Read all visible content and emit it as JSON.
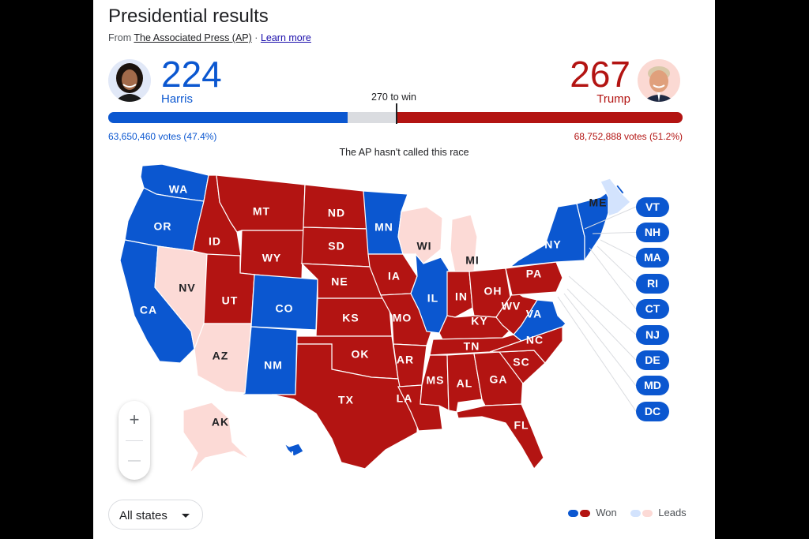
{
  "header": {
    "title": "Presidential results",
    "source_prefix": "From",
    "source_name": "The Associated Press (AP)",
    "separator": "·",
    "learn_more": "Learn more"
  },
  "candidates": {
    "harris": {
      "name": "Harris",
      "electoral_votes": "224",
      "votes_text": "63,650,460 votes (47.4%)",
      "electoral_fraction": 0.4164,
      "color": "#0b57d0"
    },
    "trump": {
      "name": "Trump",
      "electoral_votes": "267",
      "votes_text": "68,752,888 votes (51.2%)",
      "electoral_fraction": 0.4963,
      "color": "#b31412"
    }
  },
  "threshold": {
    "label": "270 to win",
    "fraction": 0.5019
  },
  "status": "The AP hasn't called this race",
  "colors": {
    "dem_won": "#0b57d0",
    "rep_won": "#b31412",
    "dem_leads": "#d3e3fd",
    "rep_leads": "#fcdad6"
  },
  "states": {
    "WA": "dem_won",
    "OR": "dem_won",
    "CA": "dem_won",
    "NV": "rep_leads",
    "ID": "rep_won",
    "MT": "rep_won",
    "WY": "rep_won",
    "UT": "rep_won",
    "AZ": "rep_leads",
    "CO": "dem_won",
    "NM": "dem_won",
    "ND": "rep_won",
    "SD": "rep_won",
    "NE": "rep_won",
    "KS": "rep_won",
    "OK": "rep_won",
    "TX": "rep_won",
    "MN": "dem_won",
    "IA": "rep_won",
    "MO": "rep_won",
    "AR": "rep_won",
    "LA": "rep_won",
    "WI": "rep_leads",
    "IL": "dem_won",
    "MI": "rep_leads",
    "IN": "rep_won",
    "OH": "rep_won",
    "KY": "rep_won",
    "TN": "rep_won",
    "MS": "rep_won",
    "AL": "rep_won",
    "GA": "rep_won",
    "FL": "rep_won",
    "SC": "rep_won",
    "NC": "rep_won",
    "VA": "dem_won",
    "WV": "rep_won",
    "PA": "rep_won",
    "NY": "dem_won",
    "ME": "dem_leads",
    "AK": "rep_leads",
    "HI": "dem_won",
    "NE_EAST": "dem_won"
  },
  "small_states": [
    "VT",
    "NH",
    "MA",
    "RI",
    "CT",
    "NJ",
    "DE",
    "MD",
    "DC"
  ],
  "zoom_controls": {
    "zoom_in": "+",
    "zoom_out": "—"
  },
  "filter": {
    "selected": "All states"
  },
  "legend": {
    "won": "Won",
    "leads": "Leads"
  }
}
